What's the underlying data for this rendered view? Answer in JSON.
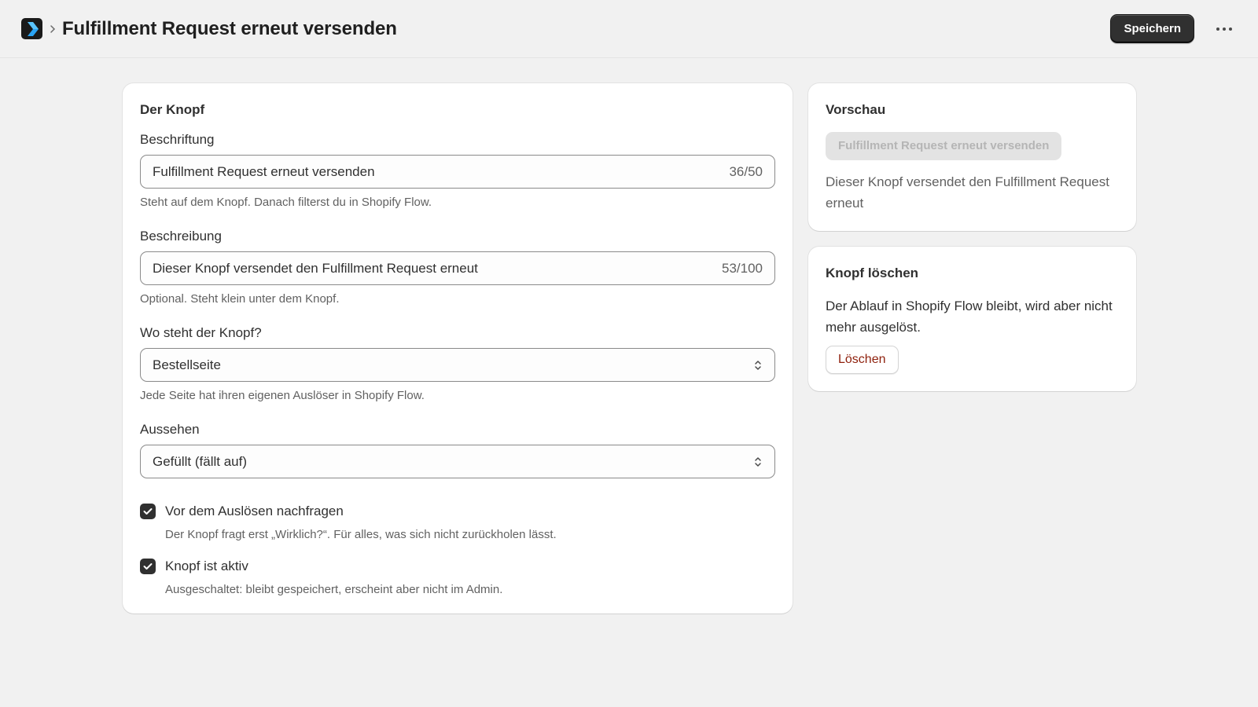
{
  "header": {
    "title": "Fulfillment Request erneut versenden",
    "save_label": "Speichern"
  },
  "main_card": {
    "title": "Der Knopf",
    "label_field": {
      "label": "Beschriftung",
      "value": "Fulfillment Request erneut versenden",
      "counter": "36/50",
      "help": "Steht auf dem Knopf. Danach filterst du in Shopify Flow."
    },
    "description_field": {
      "label": "Beschreibung",
      "value": "Dieser Knopf versendet den Fulfillment Request erneut",
      "counter": "53/100",
      "help": "Optional. Steht klein unter dem Knopf."
    },
    "location_field": {
      "label": "Wo steht der Knopf?",
      "value": "Bestellseite",
      "help": "Jede Seite hat ihren eigenen Auslöser in Shopify Flow."
    },
    "appearance_field": {
      "label": "Aussehen",
      "value": "Gefüllt (fällt auf)"
    },
    "confirm_checkbox": {
      "label": "Vor dem Auslösen nachfragen",
      "help": "Der Knopf fragt erst „Wirklich?“. Für alles, was sich nicht zurückholen lässt.",
      "checked": true
    },
    "active_checkbox": {
      "label": "Knopf ist aktiv",
      "help": "Ausgeschaltet: bleibt gespeichert, erscheint aber nicht im Admin.",
      "checked": true
    }
  },
  "preview_card": {
    "title": "Vorschau",
    "button_label": "Fulfillment Request erneut versenden",
    "description": "Dieser Knopf versendet den Fulfillment Request erneut"
  },
  "delete_card": {
    "title": "Knopf löschen",
    "text": "Der Ablauf in Shopify Flow bleibt, wird aber nicht mehr ausgelöst.",
    "button_label": "Löschen"
  },
  "icons": {
    "logo": "app-logo-icon",
    "breadcrumb": "chevron-right-icon",
    "more": "more-horizontal-icon",
    "select": "select-chevrons-icon",
    "check": "checkmark-icon"
  },
  "colors": {
    "primary_button": "#303030",
    "critical_text": "#8e1f0b",
    "background": "#f1f1f1"
  }
}
